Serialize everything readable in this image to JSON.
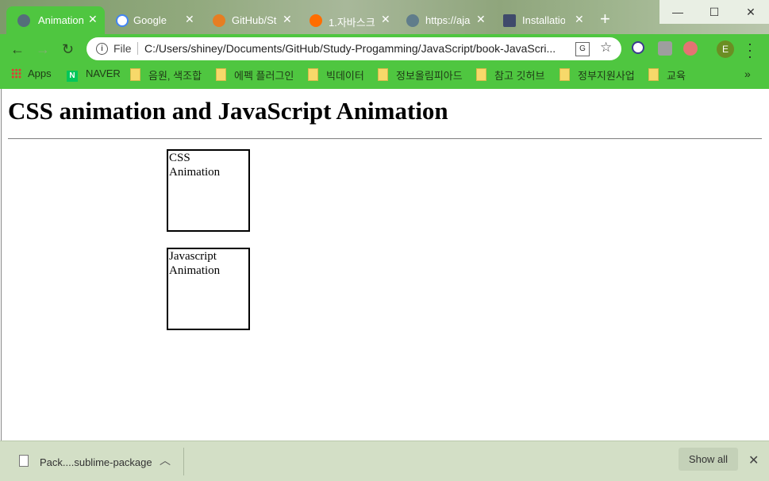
{
  "browser": {
    "tabs": [
      {
        "title": "Animation",
        "favicon": "globe-icon",
        "active": true
      },
      {
        "title": "Google",
        "favicon": "google-icon",
        "active": false
      },
      {
        "title": "GitHub/St",
        "favicon": "github-icon",
        "active": false
      },
      {
        "title": "1.자바스크",
        "favicon": "blog-icon",
        "active": false
      },
      {
        "title": "https://aja",
        "favicon": "globe-icon",
        "active": false
      },
      {
        "title": "Installatio",
        "favicon": "doc-icon",
        "active": false
      }
    ],
    "new_tab_label": "+",
    "window_controls": {
      "minimize": "—",
      "maximize": "☐",
      "close": "✕"
    },
    "scheme_label": "File",
    "url": "C:/Users/shiney/Documents/GitHub/Study-Progamming/JavaScript/book-JavaScri...",
    "profile_initial": "E",
    "bookmarks": [
      {
        "label": "Apps",
        "icon": "apps-grid-icon"
      },
      {
        "label": "NAVER",
        "icon": "naver-icon"
      },
      {
        "label": "음원, 색조합",
        "icon": "folder-icon"
      },
      {
        "label": "에펙 플러그인",
        "icon": "folder-icon"
      },
      {
        "label": "빅데이터",
        "icon": "folder-icon"
      },
      {
        "label": "정보올림피아드",
        "icon": "folder-icon"
      },
      {
        "label": "참고 깃허브",
        "icon": "folder-icon"
      },
      {
        "label": "정부지원사업",
        "icon": "folder-icon"
      },
      {
        "label": "교육",
        "icon": "folder-icon"
      }
    ],
    "bookmarks_overflow": "»"
  },
  "page": {
    "heading": "CSS animation and JavaScript Animation",
    "css_box": {
      "line1": "CSS",
      "line2": "Animation"
    },
    "js_box": {
      "line1": "Javascript",
      "line2": "Animation"
    }
  },
  "download_shelf": {
    "file_name": "Pack....sublime-package",
    "show_all_label": "Show all",
    "close_label": "✕"
  },
  "colors": {
    "toolbar_green": "#4fc640",
    "shelf_bg": "#d3dfc6"
  }
}
